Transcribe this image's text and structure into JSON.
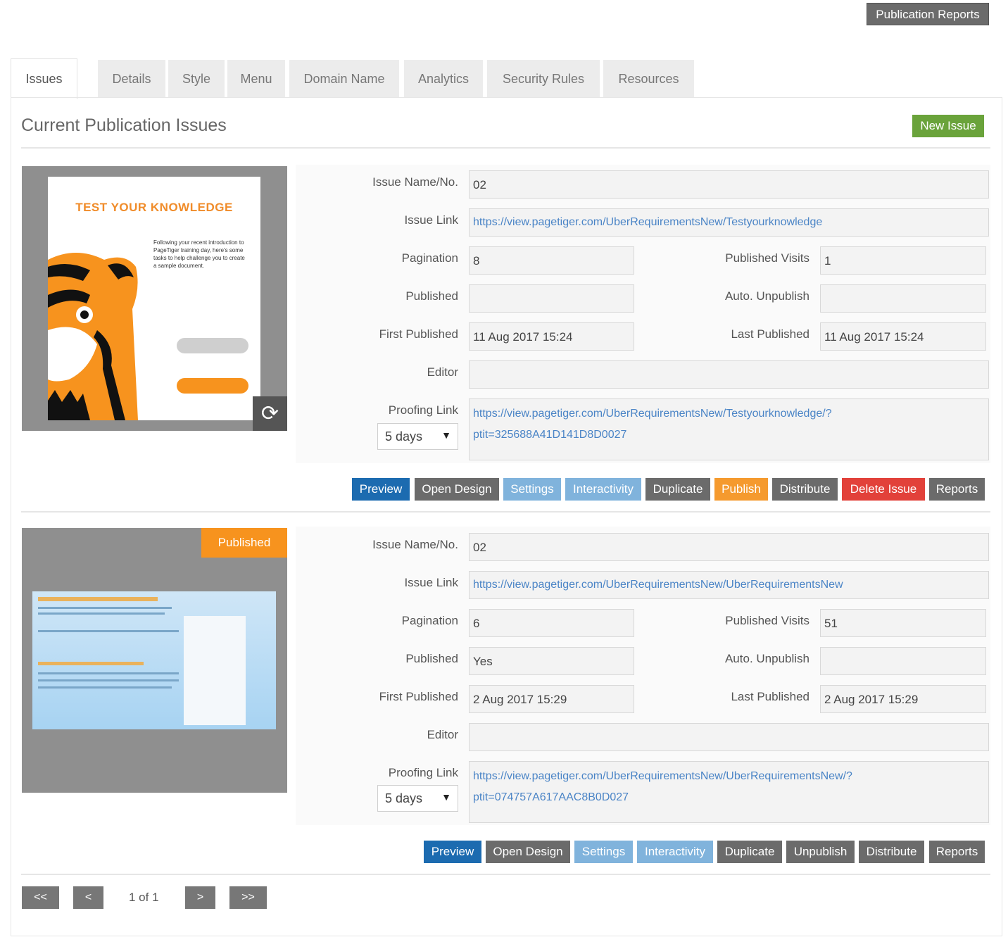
{
  "header": {
    "publication_reports": "Publication Reports"
  },
  "tabs": [
    "Issues",
    "Details",
    "Style",
    "Menu",
    "Domain Name",
    "Analytics",
    "Security Rules",
    "Resources"
  ],
  "main": {
    "title": "Current Publication Issues",
    "new_issue": "New Issue"
  },
  "labels": {
    "name": "Issue Name/No.",
    "link": "Issue Link",
    "pagination": "Pagination",
    "published_visits": "Published Visits",
    "published": "Published",
    "auto_unpublish": "Auto. Unpublish",
    "first_published": "First Published",
    "last_published": "Last Published",
    "editor": "Editor",
    "proofing_link": "Proofing Link"
  },
  "issues": [
    {
      "thumb": {
        "heading": "TEST YOUR KNOWLEDGE",
        "body": "Following your recent introduction to PageTiger training day, here's some tasks to help challenge you to create a sample document.",
        "refresh_icon": "refresh-icon"
      },
      "name": "02",
      "link": "https://view.pagetiger.com/UberRequirementsNew/Testyourknowledge",
      "pagination": "8",
      "published_visits": "1",
      "published": "",
      "auto_unpublish": "",
      "first_published": "11 Aug 2017 15:24",
      "last_published": "11 Aug 2017 15:24",
      "editor": "",
      "proofing_select": "5 days",
      "proofing_link_1": "https://view.pagetiger.com/UberRequirementsNew/Testyourknowledge/?",
      "proofing_link_2": "ptit=325688A41D141D8D0027",
      "actions": [
        "Preview",
        "Open Design",
        "Settings",
        "Interactivity",
        "Duplicate",
        "Publish",
        "Distribute",
        "Delete Issue",
        "Reports"
      ]
    },
    {
      "thumb": {
        "badge": "Published"
      },
      "name": "02",
      "link": "https://view.pagetiger.com/UberRequirementsNew/UberRequirementsNew",
      "pagination": "6",
      "published_visits": "51",
      "published": "Yes",
      "auto_unpublish": "",
      "first_published": "2 Aug 2017 15:29",
      "last_published": "2 Aug 2017 15:29",
      "editor": "",
      "proofing_select": "5 days",
      "proofing_link_1": "https://view.pagetiger.com/UberRequirementsNew/UberRequirementsNew/?",
      "proofing_link_2": "ptit=074757A617AAC8B0D027",
      "actions": [
        "Preview",
        "Open Design",
        "Settings",
        "Interactivity",
        "Duplicate",
        "Unpublish",
        "Distribute",
        "Reports"
      ]
    }
  ],
  "pagination": {
    "first": "<<",
    "prev": "<",
    "page_text": "1 of 1",
    "next": ">",
    "last": ">>"
  },
  "colors": {
    "preview": "#1c6bb0",
    "dark": "#6b6b6b",
    "light_blue": "#80b3dc",
    "publish": "#f59a2e",
    "delete": "#e2413a",
    "new_issue": "#6aa33b"
  }
}
